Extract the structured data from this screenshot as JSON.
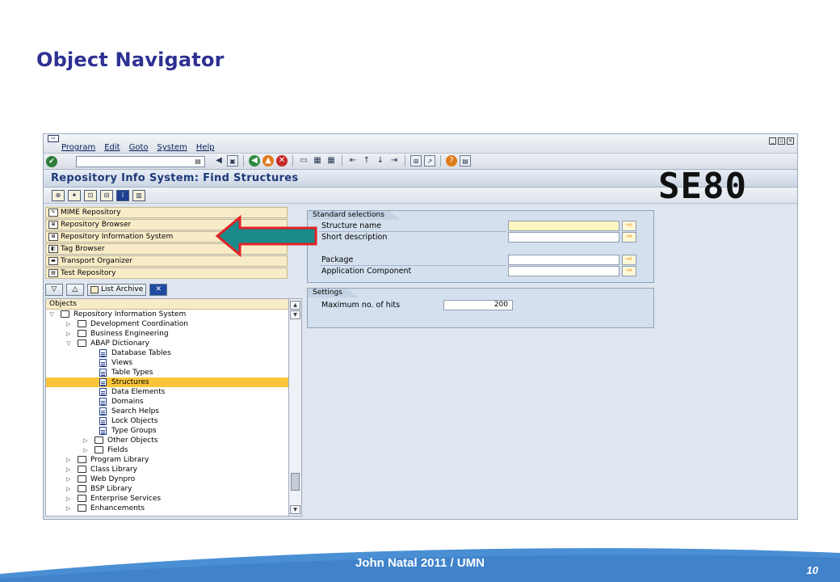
{
  "slide": {
    "title": "Object Navigator",
    "annotation": "SE80",
    "footer": "John Natal 2011 / UMN",
    "page_number": "10"
  },
  "sap": {
    "menu": [
      "Program",
      "Edit",
      "Goto",
      "System",
      "Help"
    ],
    "title": "Repository Info System: Find Structures",
    "nav_items": [
      {
        "label": "MIME Repository",
        "icon": "mime-icon"
      },
      {
        "label": "Repository Browser",
        "icon": "tree-icon"
      },
      {
        "label": "Repository Information System",
        "icon": "infosystem-icon"
      },
      {
        "label": "Tag Browser",
        "icon": "tag-icon"
      },
      {
        "label": "Transport Organizer",
        "icon": "truck-icon"
      },
      {
        "label": "Test Repository",
        "icon": "test-icon"
      }
    ],
    "nav_toolbar": {
      "list_archive": "List Archive"
    },
    "tree": {
      "header": "Objects",
      "rows": [
        {
          "label": "Repository Information System",
          "level": 0,
          "type": "folder",
          "expanded": true
        },
        {
          "label": "Development Coordination",
          "level": 1,
          "type": "folder",
          "expanded": false
        },
        {
          "label": "Business Engineering",
          "level": 1,
          "type": "folder",
          "expanded": false
        },
        {
          "label": "ABAP Dictionary",
          "level": 1,
          "type": "folder",
          "expanded": true
        },
        {
          "label": "Database Tables",
          "level": 2,
          "type": "doc"
        },
        {
          "label": "Views",
          "level": 2,
          "type": "doc"
        },
        {
          "label": "Table Types",
          "level": 2,
          "type": "doc"
        },
        {
          "label": "Structures",
          "level": 2,
          "type": "doc",
          "selected": true
        },
        {
          "label": "Data Elements",
          "level": 2,
          "type": "doc"
        },
        {
          "label": "Domains",
          "level": 2,
          "type": "doc"
        },
        {
          "label": "Search Helps",
          "level": 2,
          "type": "doc"
        },
        {
          "label": "Lock Objects",
          "level": 2,
          "type": "doc"
        },
        {
          "label": "Type Groups",
          "level": 2,
          "type": "doc"
        },
        {
          "label": "Other Objects",
          "level": 2,
          "type": "folder",
          "expanded": false
        },
        {
          "label": "Fields",
          "level": 2,
          "type": "folder",
          "expanded": false
        },
        {
          "label": "Program Library",
          "level": 1,
          "type": "folder",
          "expanded": false
        },
        {
          "label": "Class Library",
          "level": 1,
          "type": "folder",
          "expanded": false
        },
        {
          "label": "Web Dynpro",
          "level": 1,
          "type": "folder",
          "expanded": false
        },
        {
          "label": "BSP Library",
          "level": 1,
          "type": "folder",
          "expanded": false
        },
        {
          "label": "Enterprise Services",
          "level": 1,
          "type": "folder",
          "expanded": false
        },
        {
          "label": "Enhancements",
          "level": 1,
          "type": "folder",
          "expanded": false
        }
      ]
    },
    "standard_selections": {
      "title": "Standard selections",
      "structure_name": "Structure name",
      "short_description": "Short description",
      "package": "Package",
      "application_component": "Application Component"
    },
    "settings": {
      "title": "Settings",
      "max_hits_label": "Maximum no. of hits",
      "max_hits_value": "200"
    }
  },
  "colors": {
    "title_blue": "#2e3192",
    "selection_yellow": "#f9c63a",
    "arrow_red": "#e32228",
    "arrow_teal": "#1a8a8a",
    "footer_blue": "#4a8fd4"
  }
}
